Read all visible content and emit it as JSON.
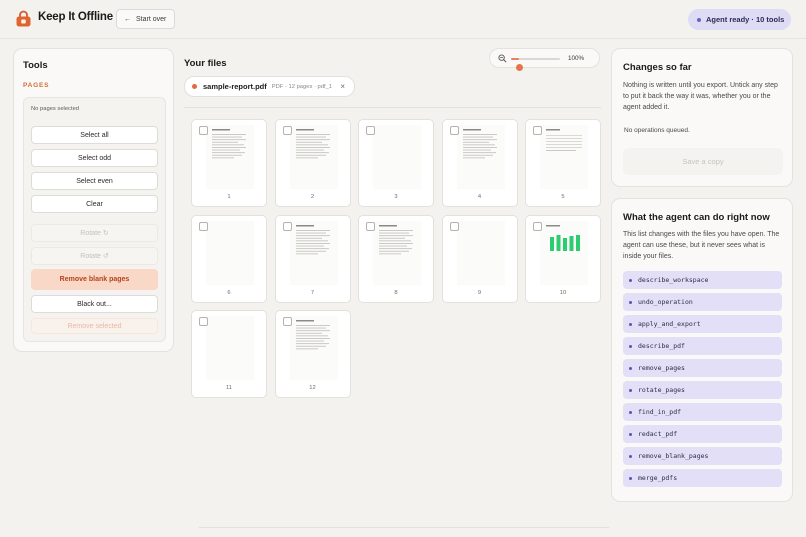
{
  "header": {
    "title": "Keep It Offline",
    "start_over": "Start over",
    "agent_status": "Agent ready · 10 tools"
  },
  "tools": {
    "title": "Tools",
    "section": "PAGES",
    "selection_count": "No pages selected",
    "buttons": {
      "select_all": "Select all",
      "select_odd": "Select odd",
      "select_even": "Select even",
      "clear": "Clear",
      "rotate_cw": "Rotate ↻",
      "rotate_ccw": "Rotate ↺",
      "remove_blank": "Remove blank pages",
      "black_out": "Black out...",
      "remove_selected": "Remove selected"
    }
  },
  "files": {
    "title": "Your files",
    "zoom": "100%",
    "zoom_level": 0.17,
    "file": {
      "name": "sample-report.pdf",
      "meta": "PDF · 12 pages · pdf_1"
    },
    "pages": [
      "1",
      "2",
      "3",
      "4",
      "5",
      "6",
      "7",
      "8",
      "9",
      "10",
      "11",
      "12"
    ]
  },
  "changes": {
    "title": "Changes so far",
    "body": "Nothing is written until you export. Untick any step to put it back the way it was, whether you or the agent added it.",
    "status": "No operations queued.",
    "save": "Save a copy"
  },
  "agent": {
    "title": "What the agent can do right now",
    "body": "This list changes with the files you have open. The agent can use these, but it never sees what is inside your files.",
    "tools": [
      "describe_workspace",
      "undo_operation",
      "apply_and_export",
      "describe_pdf",
      "remove_pages",
      "rotate_pages",
      "find_in_pdf",
      "redact_pdf",
      "remove_blank_pages",
      "merge_pdfs"
    ]
  },
  "colors": {
    "accent": "#e26a3c",
    "agent": "#dedbf5",
    "chart_green": "#2ecc71"
  }
}
